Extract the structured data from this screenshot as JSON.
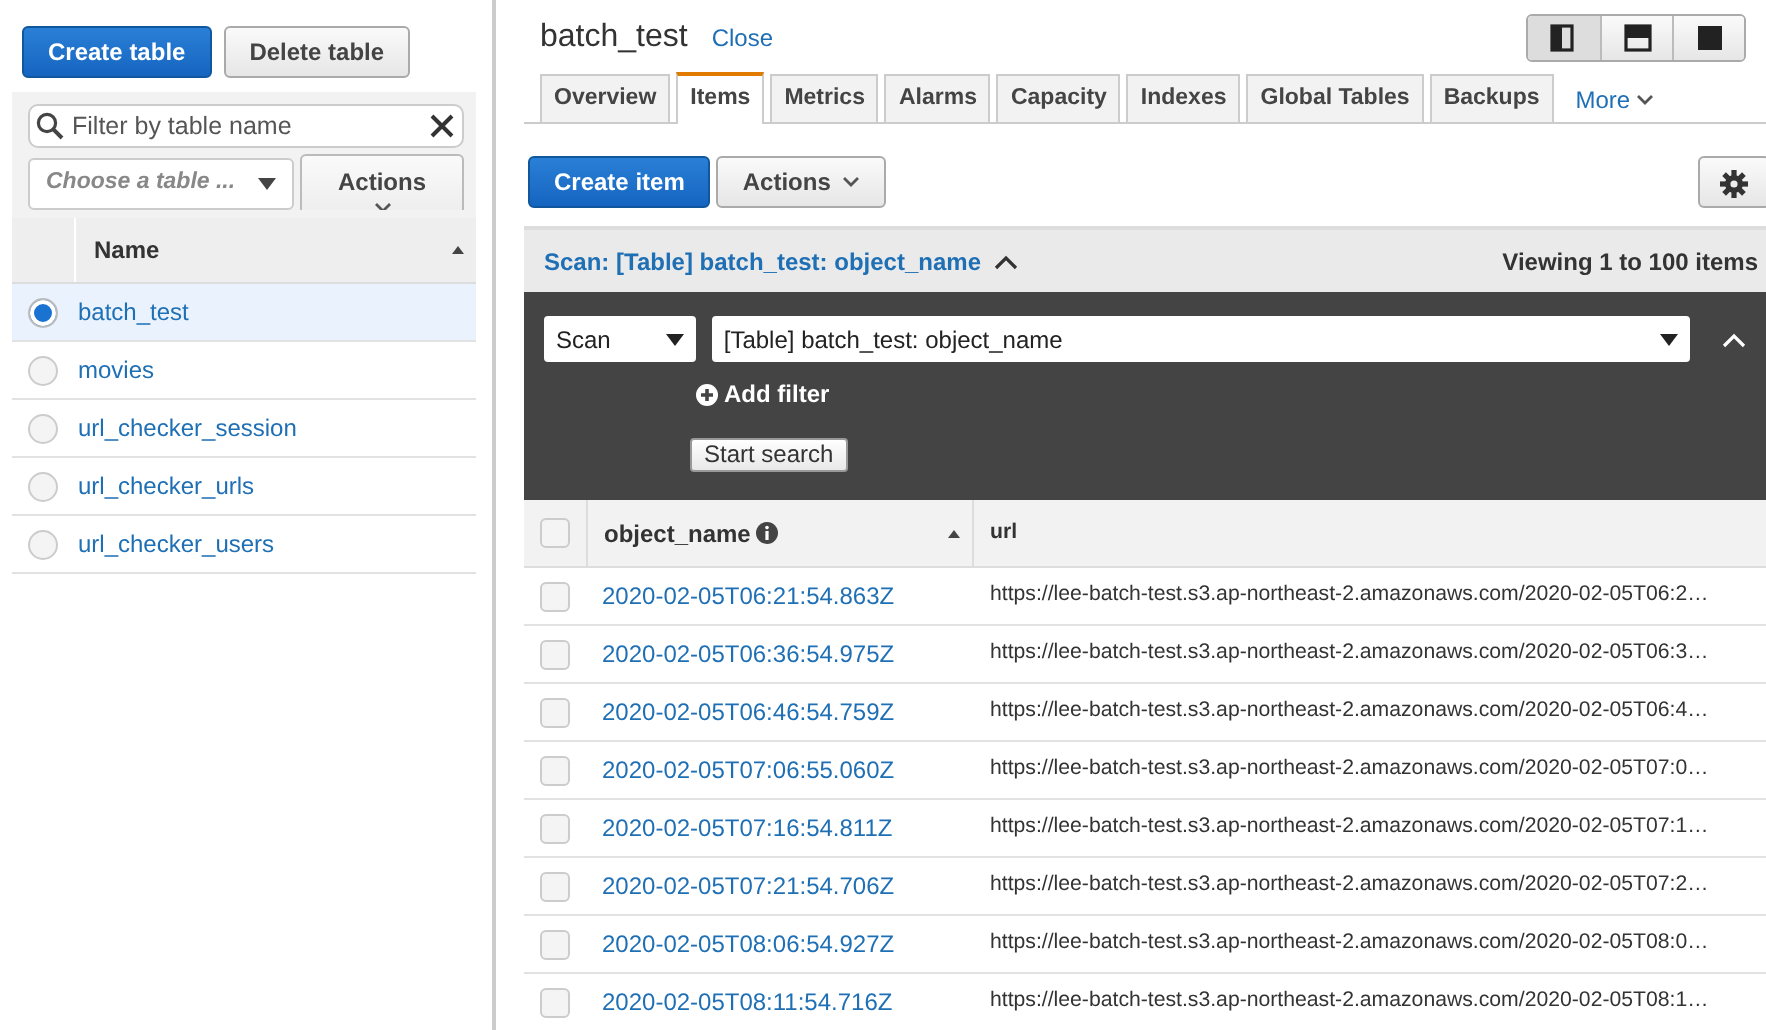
{
  "sidebar": {
    "buttons": [
      {
        "label": "Create table",
        "kind": "primary"
      },
      {
        "label": "Delete table",
        "kind": "default"
      }
    ],
    "filter": {
      "placeholder": "Filter by table name"
    },
    "table_select": {
      "placeholder": "Choose a table ..."
    },
    "actions_button": "Actions",
    "column": "Name",
    "tables": [
      {
        "name": "batch_test",
        "selected": true
      },
      {
        "name": "movies",
        "selected": false
      },
      {
        "name": "url_checker_session",
        "selected": false
      },
      {
        "name": "url_checker_urls",
        "selected": false
      },
      {
        "name": "url_checker_users",
        "selected": false
      }
    ]
  },
  "main": {
    "title": "batch_test",
    "close_link": "Close",
    "tabs": [
      {
        "label": "Overview",
        "selected": false
      },
      {
        "label": "Items",
        "selected": true
      },
      {
        "label": "Metrics",
        "selected": false
      },
      {
        "label": "Alarms",
        "selected": false
      },
      {
        "label": "Capacity",
        "selected": false
      },
      {
        "label": "Indexes",
        "selected": false
      },
      {
        "label": "Global Tables",
        "selected": false
      },
      {
        "label": "Backups",
        "selected": false
      }
    ],
    "more_tab": "More",
    "toolbar": [
      {
        "label": "Create item",
        "kind": "primary"
      },
      {
        "label": "Actions",
        "kind": "dropdown"
      }
    ],
    "scan_bar": {
      "title": "Scan: [Table] batch_test: object_name",
      "expanded": true,
      "count": "Viewing 1 to 100 items"
    },
    "query": {
      "mode": "Scan",
      "target": "[Table] batch_test: object_name",
      "add_filter": "Add filter",
      "search_button": "Start search"
    },
    "items_table": {
      "all_checked": false,
      "columns": [
        "object_name",
        "url"
      ],
      "rows": [
        {
          "object_name": "2020-02-05T06:21:54.863Z",
          "url": "https://lee-batch-test.s3.ap-northeast-2.amazonaws.com/2020-02-05T06:2…",
          "checked": false
        },
        {
          "object_name": "2020-02-05T06:36:54.975Z",
          "url": "https://lee-batch-test.s3.ap-northeast-2.amazonaws.com/2020-02-05T06:3…",
          "checked": false
        },
        {
          "object_name": "2020-02-05T06:46:54.759Z",
          "url": "https://lee-batch-test.s3.ap-northeast-2.amazonaws.com/2020-02-05T06:4…",
          "checked": false
        },
        {
          "object_name": "2020-02-05T07:06:55.060Z",
          "url": "https://lee-batch-test.s3.ap-northeast-2.amazonaws.com/2020-02-05T07:0…",
          "checked": false
        },
        {
          "object_name": "2020-02-05T07:16:54.811Z",
          "url": "https://lee-batch-test.s3.ap-northeast-2.amazonaws.com/2020-02-05T07:1…",
          "checked": false
        },
        {
          "object_name": "2020-02-05T07:21:54.706Z",
          "url": "https://lee-batch-test.s3.ap-northeast-2.amazonaws.com/2020-02-05T07:2…",
          "checked": false
        },
        {
          "object_name": "2020-02-05T08:06:54.927Z",
          "url": "https://lee-batch-test.s3.ap-northeast-2.amazonaws.com/2020-02-05T08:0…",
          "checked": false
        },
        {
          "object_name": "2020-02-05T08:11:54.716Z",
          "url": "https://lee-batch-test.s3.ap-northeast-2.amazonaws.com/2020-02-05T08:1…",
          "checked": false
        }
      ]
    }
  }
}
